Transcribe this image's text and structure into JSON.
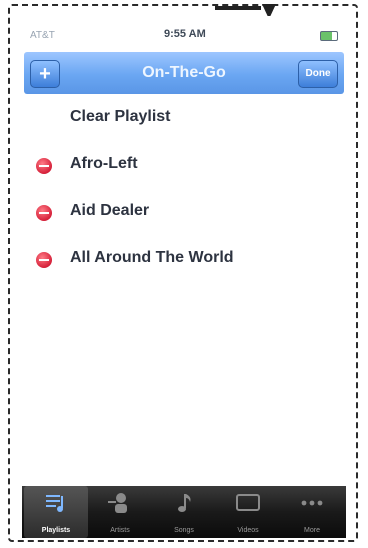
{
  "status_bar": {
    "carrier": "AT&T",
    "time": "9:55 AM"
  },
  "nav_bar": {
    "title": "On-The-Go",
    "add_label": "+",
    "done_label": "Done"
  },
  "list": {
    "clear_label": "Clear Playlist",
    "items": [
      {
        "label": "Afro-Left"
      },
      {
        "label": "Aid Dealer"
      },
      {
        "label": "All Around The World"
      }
    ]
  },
  "tab_bar": {
    "tabs": [
      {
        "label": "Playlists",
        "icon": "playlists-icon",
        "selected": true
      },
      {
        "label": "Artists",
        "icon": "artists-icon",
        "selected": false
      },
      {
        "label": "Songs",
        "icon": "songs-icon",
        "selected": false
      },
      {
        "label": "Videos",
        "icon": "videos-icon",
        "selected": false
      },
      {
        "label": "More",
        "icon": "more-icon",
        "selected": false
      }
    ]
  },
  "colors": {
    "nav_gradient_top": "#9dc6ff",
    "nav_gradient_bottom": "#5a96e6",
    "delete_red": "#d6213a",
    "tab_bar": "#1a1a1a"
  }
}
